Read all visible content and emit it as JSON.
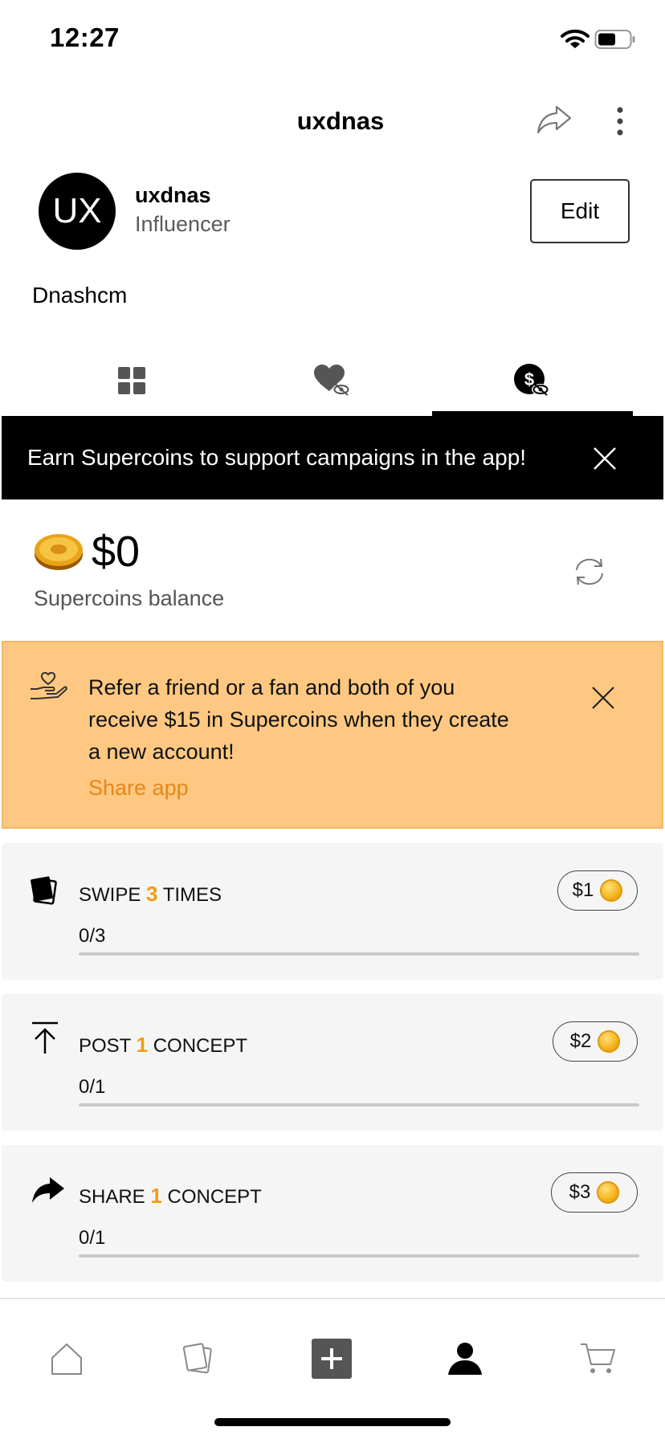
{
  "status_bar": {
    "time": "12:27"
  },
  "header": {
    "title": "uxdnas"
  },
  "profile": {
    "avatar_initials": "UX",
    "username": "uxdnas",
    "role": "Influencer",
    "edit_label": "Edit",
    "bio": "Dnashcm"
  },
  "tabs": [
    {
      "icon": "grid-icon",
      "active": false
    },
    {
      "icon": "heart-eye-icon",
      "active": false
    },
    {
      "icon": "dollar-eye-icon",
      "active": true
    }
  ],
  "banner": {
    "text": "Earn Supercoins to support campaigns in the app!"
  },
  "balance": {
    "amount": "$0",
    "label": "Supercoins balance"
  },
  "referral": {
    "text": "Refer a friend or a fan and both of you receive $15 in Supercoins when they create a new account!",
    "link_label": "Share app"
  },
  "tasks": [
    {
      "pre": "SWIPE ",
      "count": "3",
      "post": " TIMES",
      "progress": "0/3",
      "progress_fraction": 0,
      "reward": "$1",
      "icon": "cards-icon"
    },
    {
      "pre": "POST ",
      "count": "1",
      "post": " CONCEPT",
      "progress": "0/1",
      "progress_fraction": 0,
      "reward": "$2",
      "icon": "upload-icon"
    },
    {
      "pre": "SHARE ",
      "count": "1",
      "post": " CONCEPT",
      "progress": "0/1",
      "progress_fraction": 0,
      "reward": "$3",
      "icon": "share-arrow-icon"
    }
  ],
  "nav": [
    {
      "icon": "home-icon",
      "active": false
    },
    {
      "icon": "cards-icon",
      "active": false
    },
    {
      "icon": "add-icon",
      "active": false
    },
    {
      "icon": "profile-icon",
      "active": true
    },
    {
      "icon": "cart-icon",
      "active": false
    }
  ],
  "colors": {
    "accent": "#f29d12",
    "referral_bg": "#fec882",
    "link": "#e8861a",
    "banner_bg": "#000000"
  }
}
